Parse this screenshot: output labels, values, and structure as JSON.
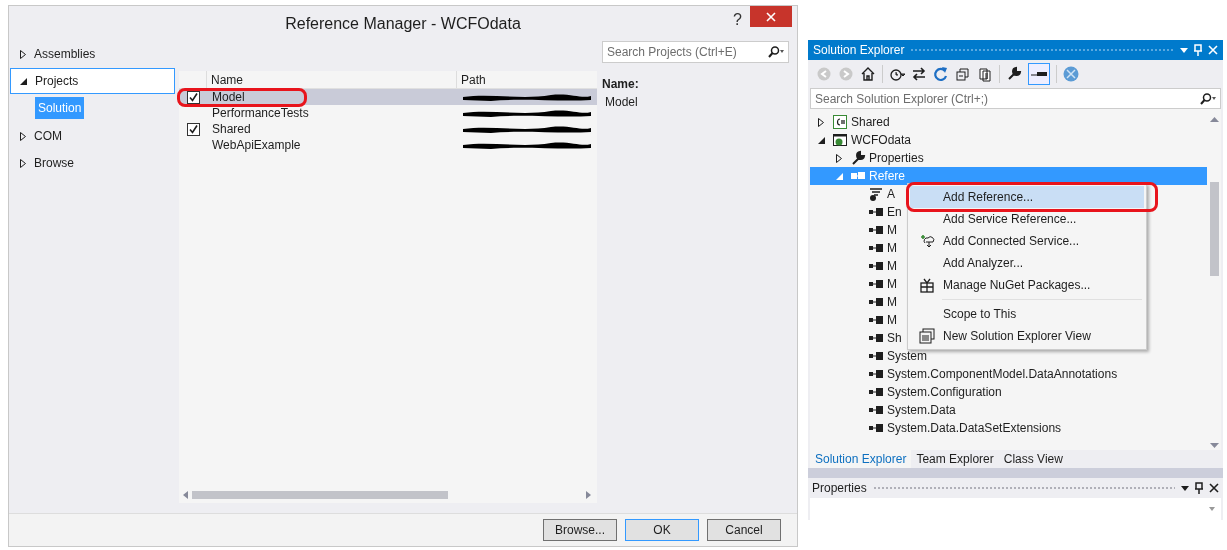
{
  "dialog": {
    "title": "Reference Manager - WCFOdata",
    "help": "?",
    "nav": [
      {
        "label": "Assemblies",
        "expanded": false,
        "selected": false
      },
      {
        "label": "Projects",
        "expanded": true,
        "selected": true,
        "children": [
          {
            "label": "Solution",
            "selected": true
          }
        ]
      },
      {
        "label": "COM",
        "expanded": false,
        "selected": false
      },
      {
        "label": "Browse",
        "expanded": false,
        "selected": false
      }
    ],
    "search": {
      "placeholder": "Search Projects (Ctrl+E)"
    },
    "table": {
      "columns": [
        "Name",
        "Path"
      ],
      "rows": [
        {
          "name": "Model",
          "checked": true,
          "selected": true,
          "highlighted": true
        },
        {
          "name": "PerformanceTests",
          "checked": false,
          "selected": false,
          "highlighted": false
        },
        {
          "name": "Shared",
          "checked": true,
          "selected": false,
          "highlighted": false
        },
        {
          "name": "WebApiExample",
          "checked": false,
          "selected": false,
          "highlighted": false
        }
      ]
    },
    "details": {
      "label": "Name:",
      "value": "Model"
    },
    "buttons": [
      {
        "label": "Browse...",
        "default": false
      },
      {
        "label": "OK",
        "default": true
      },
      {
        "label": "Cancel",
        "default": false
      }
    ]
  },
  "solution_explorer": {
    "title": "Solution Explorer",
    "search": {
      "placeholder": "Search Solution Explorer (Ctrl+;)"
    },
    "tree": [
      {
        "label": "Shared",
        "kind": "csharp",
        "expanded": false,
        "selected": false
      },
      {
        "label": "WCFOdata",
        "kind": "web",
        "expanded": true,
        "selected": false,
        "children": [
          {
            "label": "Properties",
            "kind": "wrench",
            "expanded": false,
            "selected": false
          },
          {
            "label": "Refere",
            "kind": "references",
            "expanded": true,
            "selected": true,
            "children": [
              {
                "label": "A",
                "kind": "analyzer",
                "selected": false
              },
              {
                "label": "En",
                "kind": "assembly",
                "selected": false
              },
              {
                "label": "M",
                "kind": "assembly",
                "selected": false
              },
              {
                "label": "M",
                "kind": "assembly",
                "selected": false
              },
              {
                "label": "M",
                "kind": "assembly",
                "selected": false
              },
              {
                "label": "M",
                "kind": "assembly",
                "selected": false
              },
              {
                "label": "M",
                "kind": "assembly",
                "selected": false
              },
              {
                "label": "M",
                "kind": "assembly",
                "selected": false
              },
              {
                "label": "Sh",
                "kind": "assembly",
                "selected": false
              },
              {
                "label": "System",
                "kind": "assembly",
                "selected": false
              },
              {
                "label": "System.ComponentModel.DataAnnotations",
                "kind": "assembly",
                "selected": false
              },
              {
                "label": "System.Configuration",
                "kind": "assembly",
                "selected": false
              },
              {
                "label": "System.Data",
                "kind": "assembly",
                "selected": false
              },
              {
                "label": "System.Data.DataSetExtensions",
                "kind": "assembly",
                "selected": false
              }
            ]
          }
        ]
      }
    ],
    "context_menu": [
      {
        "kind": "plain",
        "label": "Add Reference...",
        "highlighted": true
      },
      {
        "kind": "plain",
        "label": "Add Service Reference...",
        "highlighted": false
      },
      {
        "kind": "connected",
        "label": "Add Connected Service...",
        "highlighted": false
      },
      {
        "kind": "plain",
        "label": "Add Analyzer...",
        "highlighted": false
      },
      {
        "kind": "package",
        "label": "Manage NuGet Packages...",
        "highlighted": false
      },
      {
        "kind": "separator"
      },
      {
        "kind": "plain",
        "label": "Scope to This",
        "highlighted": false
      },
      {
        "kind": "window",
        "label": "New Solution Explorer View",
        "highlighted": false
      }
    ],
    "tabs": [
      {
        "label": "Solution Explorer",
        "selected": true
      },
      {
        "label": "Team Explorer",
        "selected": false
      },
      {
        "label": "Class View",
        "selected": false
      }
    ],
    "properties": {
      "title": "Properties"
    }
  }
}
